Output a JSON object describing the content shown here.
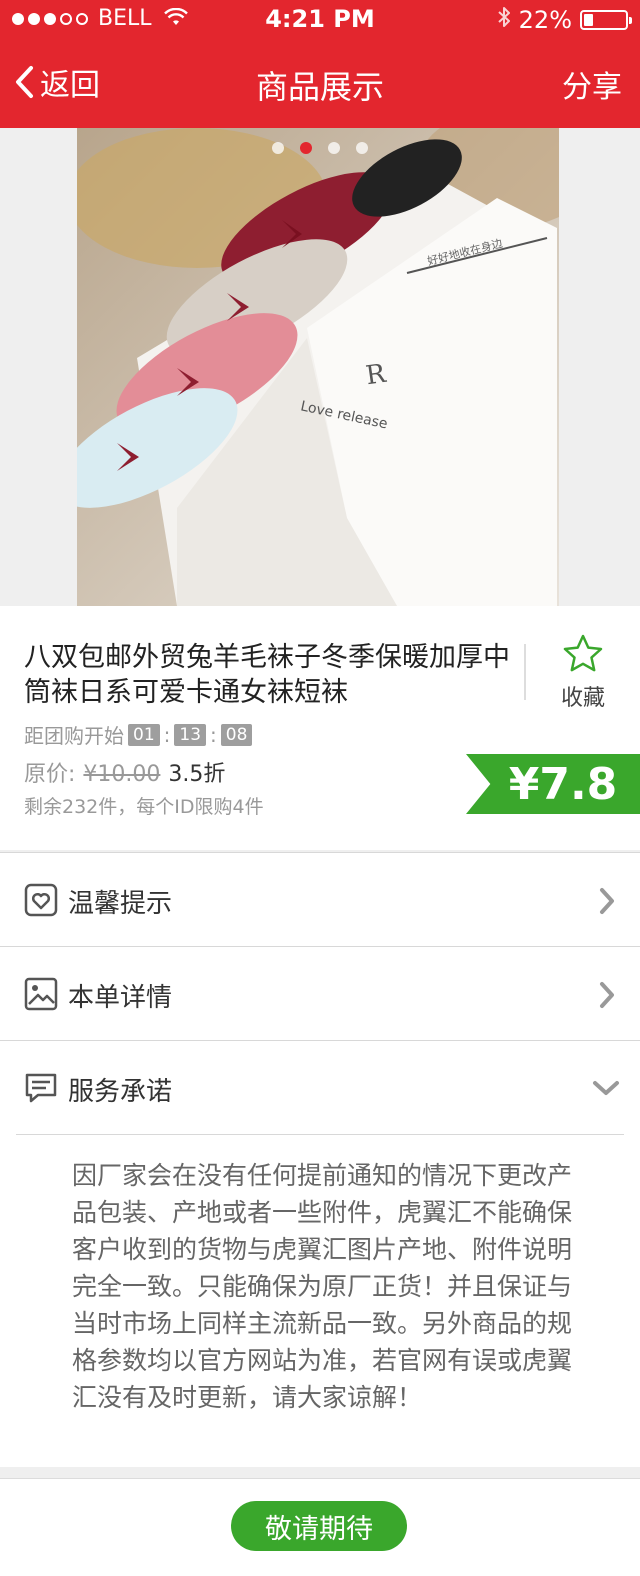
{
  "status_bar": {
    "carrier": "BELL",
    "time": "4:21 PM",
    "battery": "22%",
    "battery_level": 0.22,
    "signal_bars_filled": 3,
    "signal_bars_total": 5
  },
  "nav": {
    "back_label": "返回",
    "title": "商品展示",
    "share_label": "分享"
  },
  "gallery": {
    "slide_count": 4,
    "active_index": 1,
    "box_text": "Love release",
    "box_script": "好好地收在身边"
  },
  "product": {
    "title": "八双包邮外贸兔羊毛袜子冬季保暖加厚中筒袜日系可爱卡通女袜短袜",
    "favorite_label": "收藏",
    "countdown_label": "距团购开始",
    "countdown": {
      "hours": "01",
      "minutes": "13",
      "seconds": "08"
    },
    "original_price_label": "原价:",
    "original_price": "¥10.00",
    "discount": "3.5折",
    "stock_text": "剩余232件，每个ID限购4件",
    "price": "¥7.8"
  },
  "sections": [
    {
      "label": "温馨提示",
      "icon": "heart-icon"
    },
    {
      "label": "本单详情",
      "icon": "image-icon"
    },
    {
      "label": "服务承诺",
      "icon": "message-icon"
    }
  ],
  "service_promise": "因厂家会在没有任何提前通知的情况下更改产品包装、产地或者一些附件，虎翼汇不能确保客户收到的货物与虎翼汇图片产地、附件说明完全一致。只能确保为原厂正货！并且保证与当时市场上同样主流新品一致。另外商品的规格参数均以官方网站为准，若官网有误或虎翼汇没有及时更新，请大家谅解！",
  "footer": {
    "button_label": "敬请期待"
  },
  "colors": {
    "brand_red": "#e3262e",
    "price_green": "#3aa72c"
  }
}
